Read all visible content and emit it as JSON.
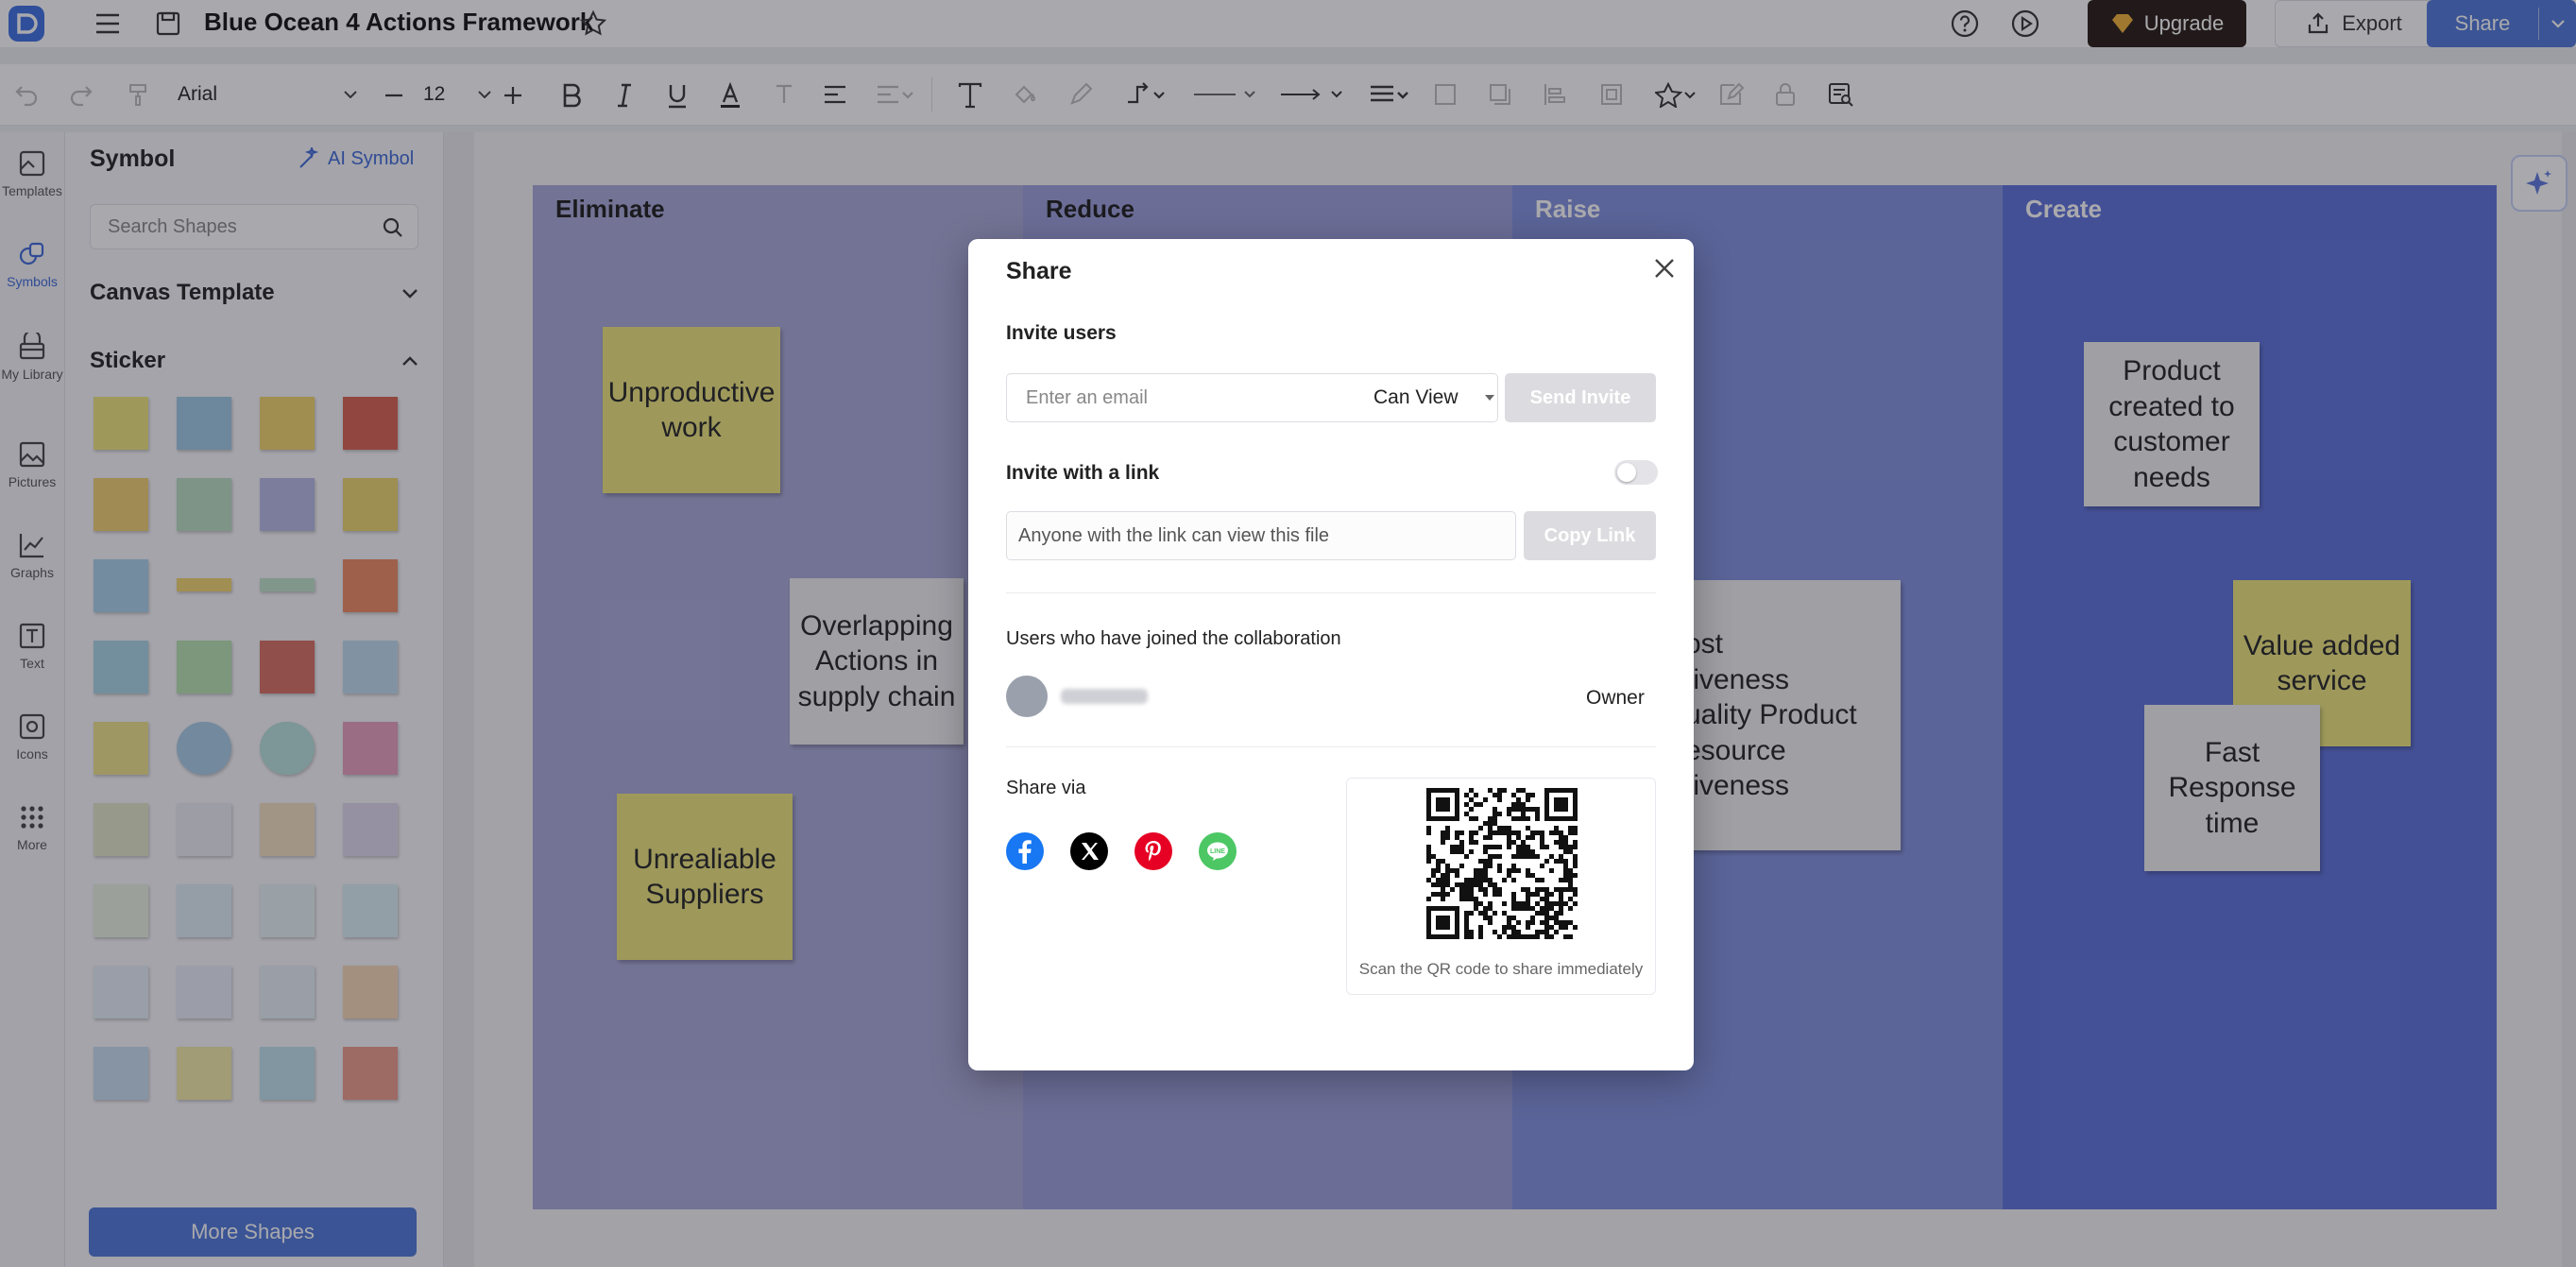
{
  "app": {
    "document_title": "Blue Ocean 4 Actions Framework",
    "upgrade_label": "Upgrade",
    "export_label": "Export",
    "share_label": "Share"
  },
  "toolbar": {
    "font_family": "Arial",
    "font_size": "12"
  },
  "rail": {
    "items": [
      {
        "label": "Templates",
        "icon": "templates-icon"
      },
      {
        "label": "Symbols",
        "icon": "symbols-icon"
      },
      {
        "label": "My Library",
        "icon": "library-icon"
      },
      {
        "label": "Pictures",
        "icon": "pictures-icon"
      },
      {
        "label": "Graphs",
        "icon": "graphs-icon"
      },
      {
        "label": "Text",
        "icon": "text-icon"
      },
      {
        "label": "Icons",
        "icon": "icons-icon"
      },
      {
        "label": "More",
        "icon": "more-icon"
      }
    ]
  },
  "panel": {
    "title": "Symbol",
    "ai_symbol_label": "AI Symbol",
    "search_placeholder": "Search Shapes",
    "section_canvas": "Canvas Template",
    "section_sticker": "Sticker",
    "more_shapes_label": "More Shapes"
  },
  "board": {
    "columns": [
      {
        "title": "Eliminate",
        "color": "#a9a9d9"
      },
      {
        "title": "Reduce",
        "color": "#9b9edb"
      },
      {
        "title": "Raise",
        "color": "#8290dd"
      },
      {
        "title": "Create",
        "color": "#5c70d9"
      }
    ],
    "notes": {
      "unproductive": "Unproductive work",
      "overlapping": "Overlapping Actions in supply chain",
      "unreliable": "Unrealiable Suppliers",
      "raise_note": "ost\ntiveness\nuality Product\nesource\ntiveness",
      "product_created": "Product created to customer needs",
      "value_added": "Value added service",
      "fast_response": "Fast Response time"
    }
  },
  "share_dialog": {
    "title": "Share",
    "invite_users": "Invite users",
    "email_placeholder": "Enter an email",
    "permission": "Can View",
    "send_invite": "Send Invite",
    "invite_with_link": "Invite with a link",
    "link_text": "Anyone with the link can view this file",
    "copy_link": "Copy Link",
    "joined_label": "Users who have joined the collaboration",
    "owner_role": "Owner",
    "share_via": "Share via",
    "qr_caption": "Scan the QR code to share immediately",
    "social": [
      "facebook-icon",
      "x-icon",
      "pinterest-icon",
      "line-icon"
    ]
  }
}
